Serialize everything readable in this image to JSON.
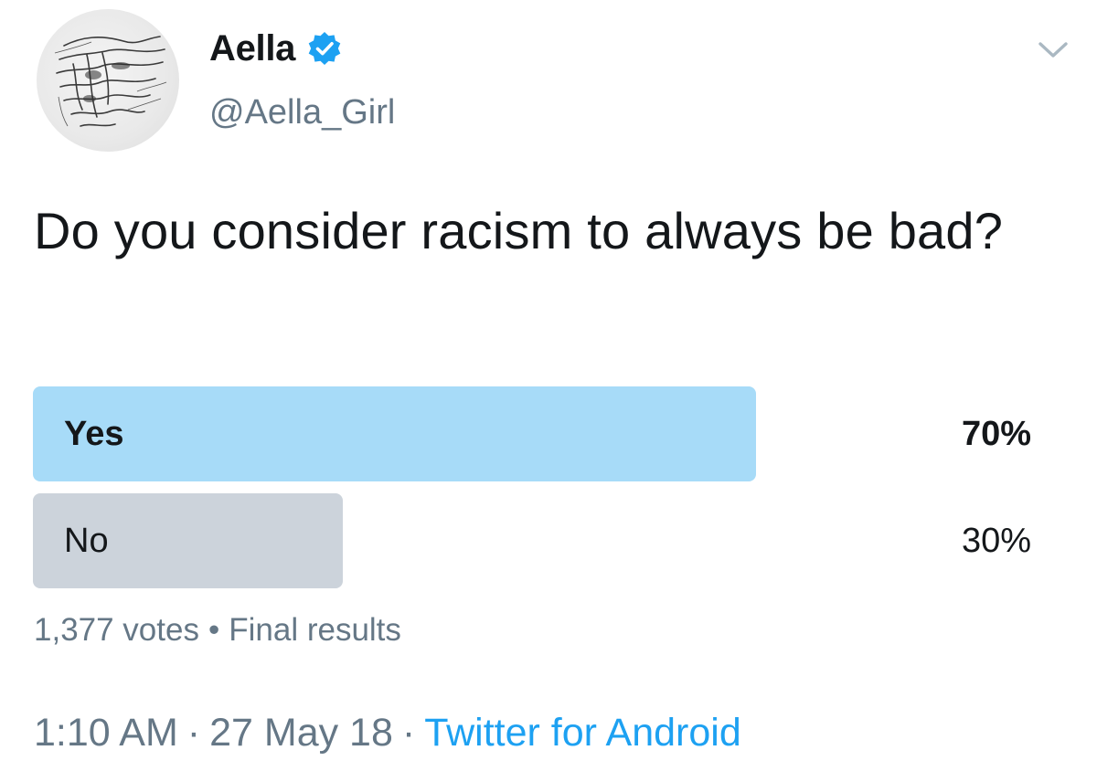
{
  "author": {
    "display_name": "Aella",
    "handle": "@Aella_Girl",
    "verified": true,
    "avatar_icon": "sketched-face-avatar"
  },
  "tweet": {
    "text": "Do you consider racism to always be bad?"
  },
  "poll": {
    "options": [
      {
        "label": "Yes",
        "percent_text": "70%",
        "fraction": 0.7,
        "color": "#a7dbf8",
        "winner": true
      },
      {
        "label": "No",
        "percent_text": "30%",
        "fraction": 0.3,
        "color": "#ccd3db",
        "winner": false
      }
    ],
    "votes": "1,377 votes",
    "separator": "•",
    "status": "Final results"
  },
  "footer": {
    "time": "1:10 AM",
    "separator": "·",
    "date": "27 May 18",
    "source": "Twitter for Android"
  },
  "colors": {
    "text": "#14171a",
    "secondary": "#657786",
    "link": "#1da1f2",
    "verified": "#1da1f2"
  },
  "icons": {
    "verified": "verified-badge-icon",
    "menu": "chevron-down-icon"
  }
}
